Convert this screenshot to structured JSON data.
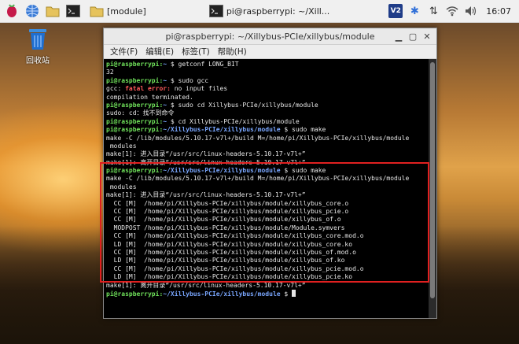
{
  "taskbar": {
    "folder_label": "[module]",
    "terminal_label": "pi@raspberrypi: ~/Xill...",
    "clock": "16:07",
    "tray_vnc": "V2"
  },
  "desktop": {
    "trash_label": "回收站"
  },
  "window": {
    "title": "pi@raspberrypi: ~/Xillybus-PCIe/xillybus/module",
    "menu": [
      "文件(F)",
      "编辑(E)",
      "标签(T)",
      "帮助(H)"
    ]
  },
  "terminal": {
    "lines": [
      {
        "user": "pi@raspberrypi",
        "path": "~",
        "cmd": " $ getconf LONG_BIT"
      },
      {
        "text": "32"
      },
      {
        "user": "pi@raspberrypi",
        "path": "~",
        "cmd": " $ sudo gcc"
      },
      {
        "pre": "gcc: ",
        "err": "fatal error:",
        "text": " no input files"
      },
      {
        "text": "compilation terminated."
      },
      {
        "user": "pi@raspberrypi",
        "path": "~",
        "cmd": " $ sudo cd Xillybus-PCIe/xillybus/module"
      },
      {
        "text": "sudo: cd：找不到命令"
      },
      {
        "user": "pi@raspberrypi",
        "path": "~",
        "cmd": " $ cd Xillybus-PCIe/xillybus/module"
      },
      {
        "user": "pi@raspberrypi",
        "path": "~/Xillybus-PCIe/xillybus/module",
        "cmd": " $ sudo make"
      },
      {
        "text": "make -C /lib/modules/5.10.17-v7l+/build M=/home/pi/Xillybus-PCIe/xillybus/module"
      },
      {
        "text": " modules"
      },
      {
        "text": "make[1]: 进入目录“/usr/src/linux-headers-5.10.17-v7l+”"
      },
      {
        "text": "make[1]: 离开目录“/usr/src/linux-headers-5.10.17-v7l+”"
      },
      {
        "user": "pi@raspberrypi",
        "path": "~/Xillybus-PCIe/xillybus/module",
        "cmd": " $ sudo make"
      },
      {
        "text": "make -C /lib/modules/5.10.17-v7l+/build M=/home/pi/Xillybus-PCIe/xillybus/module"
      },
      {
        "text": " modules"
      },
      {
        "text": "make[1]: 进入目录“/usr/src/linux-headers-5.10.17-v7l+”"
      },
      {
        "text": "  CC [M]  /home/pi/Xillybus-PCIe/xillybus/module/xillybus_core.o"
      },
      {
        "text": "  CC [M]  /home/pi/Xillybus-PCIe/xillybus/module/xillybus_pcie.o"
      },
      {
        "text": "  CC [M]  /home/pi/Xillybus-PCIe/xillybus/module/xillybus_of.o"
      },
      {
        "text": "  MODPOST /home/pi/Xillybus-PCIe/xillybus/module/Module.symvers"
      },
      {
        "text": "  CC [M]  /home/pi/Xillybus-PCIe/xillybus/module/xillybus_core.mod.o"
      },
      {
        "text": "  LD [M]  /home/pi/Xillybus-PCIe/xillybus/module/xillybus_core.ko"
      },
      {
        "text": "  CC [M]  /home/pi/Xillybus-PCIe/xillybus/module/xillybus_of.mod.o"
      },
      {
        "text": "  LD [M]  /home/pi/Xillybus-PCIe/xillybus/module/xillybus_of.ko"
      },
      {
        "text": "  CC [M]  /home/pi/Xillybus-PCIe/xillybus/module/xillybus_pcie.mod.o"
      },
      {
        "text": "  LD [M]  /home/pi/Xillybus-PCIe/xillybus/module/xillybus_pcie.ko"
      },
      {
        "text": "make[1]: 离开目录“/usr/src/linux-headers-5.10.17-v7l+”"
      },
      {
        "user": "pi@raspberrypi",
        "path": "~/Xillybus-PCIe/xillybus/module",
        "cmd": " $ ",
        "cursor": true
      }
    ]
  },
  "colors": {
    "prompt_user": "#6fe05a",
    "prompt_path": "#7aa7ff",
    "error": "#ff5b5b",
    "highlight_box": "#e02020"
  }
}
